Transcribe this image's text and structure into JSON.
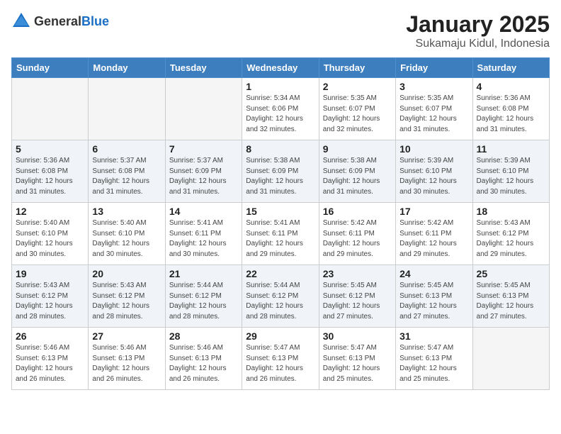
{
  "header": {
    "logo_general": "General",
    "logo_blue": "Blue",
    "title": "January 2025",
    "location": "Sukamaju Kidul, Indonesia"
  },
  "weekdays": [
    "Sunday",
    "Monday",
    "Tuesday",
    "Wednesday",
    "Thursday",
    "Friday",
    "Saturday"
  ],
  "weeks": [
    [
      {
        "day": "",
        "info": ""
      },
      {
        "day": "",
        "info": ""
      },
      {
        "day": "",
        "info": ""
      },
      {
        "day": "1",
        "info": "Sunrise: 5:34 AM\nSunset: 6:06 PM\nDaylight: 12 hours\nand 32 minutes."
      },
      {
        "day": "2",
        "info": "Sunrise: 5:35 AM\nSunset: 6:07 PM\nDaylight: 12 hours\nand 32 minutes."
      },
      {
        "day": "3",
        "info": "Sunrise: 5:35 AM\nSunset: 6:07 PM\nDaylight: 12 hours\nand 31 minutes."
      },
      {
        "day": "4",
        "info": "Sunrise: 5:36 AM\nSunset: 6:08 PM\nDaylight: 12 hours\nand 31 minutes."
      }
    ],
    [
      {
        "day": "5",
        "info": "Sunrise: 5:36 AM\nSunset: 6:08 PM\nDaylight: 12 hours\nand 31 minutes."
      },
      {
        "day": "6",
        "info": "Sunrise: 5:37 AM\nSunset: 6:08 PM\nDaylight: 12 hours\nand 31 minutes."
      },
      {
        "day": "7",
        "info": "Sunrise: 5:37 AM\nSunset: 6:09 PM\nDaylight: 12 hours\nand 31 minutes."
      },
      {
        "day": "8",
        "info": "Sunrise: 5:38 AM\nSunset: 6:09 PM\nDaylight: 12 hours\nand 31 minutes."
      },
      {
        "day": "9",
        "info": "Sunrise: 5:38 AM\nSunset: 6:09 PM\nDaylight: 12 hours\nand 31 minutes."
      },
      {
        "day": "10",
        "info": "Sunrise: 5:39 AM\nSunset: 6:10 PM\nDaylight: 12 hours\nand 30 minutes."
      },
      {
        "day": "11",
        "info": "Sunrise: 5:39 AM\nSunset: 6:10 PM\nDaylight: 12 hours\nand 30 minutes."
      }
    ],
    [
      {
        "day": "12",
        "info": "Sunrise: 5:40 AM\nSunset: 6:10 PM\nDaylight: 12 hours\nand 30 minutes."
      },
      {
        "day": "13",
        "info": "Sunrise: 5:40 AM\nSunset: 6:10 PM\nDaylight: 12 hours\nand 30 minutes."
      },
      {
        "day": "14",
        "info": "Sunrise: 5:41 AM\nSunset: 6:11 PM\nDaylight: 12 hours\nand 30 minutes."
      },
      {
        "day": "15",
        "info": "Sunrise: 5:41 AM\nSunset: 6:11 PM\nDaylight: 12 hours\nand 29 minutes."
      },
      {
        "day": "16",
        "info": "Sunrise: 5:42 AM\nSunset: 6:11 PM\nDaylight: 12 hours\nand 29 minutes."
      },
      {
        "day": "17",
        "info": "Sunrise: 5:42 AM\nSunset: 6:11 PM\nDaylight: 12 hours\nand 29 minutes."
      },
      {
        "day": "18",
        "info": "Sunrise: 5:43 AM\nSunset: 6:12 PM\nDaylight: 12 hours\nand 29 minutes."
      }
    ],
    [
      {
        "day": "19",
        "info": "Sunrise: 5:43 AM\nSunset: 6:12 PM\nDaylight: 12 hours\nand 28 minutes."
      },
      {
        "day": "20",
        "info": "Sunrise: 5:43 AM\nSunset: 6:12 PM\nDaylight: 12 hours\nand 28 minutes."
      },
      {
        "day": "21",
        "info": "Sunrise: 5:44 AM\nSunset: 6:12 PM\nDaylight: 12 hours\nand 28 minutes."
      },
      {
        "day": "22",
        "info": "Sunrise: 5:44 AM\nSunset: 6:12 PM\nDaylight: 12 hours\nand 28 minutes."
      },
      {
        "day": "23",
        "info": "Sunrise: 5:45 AM\nSunset: 6:12 PM\nDaylight: 12 hours\nand 27 minutes."
      },
      {
        "day": "24",
        "info": "Sunrise: 5:45 AM\nSunset: 6:13 PM\nDaylight: 12 hours\nand 27 minutes."
      },
      {
        "day": "25",
        "info": "Sunrise: 5:45 AM\nSunset: 6:13 PM\nDaylight: 12 hours\nand 27 minutes."
      }
    ],
    [
      {
        "day": "26",
        "info": "Sunrise: 5:46 AM\nSunset: 6:13 PM\nDaylight: 12 hours\nand 26 minutes."
      },
      {
        "day": "27",
        "info": "Sunrise: 5:46 AM\nSunset: 6:13 PM\nDaylight: 12 hours\nand 26 minutes."
      },
      {
        "day": "28",
        "info": "Sunrise: 5:46 AM\nSunset: 6:13 PM\nDaylight: 12 hours\nand 26 minutes."
      },
      {
        "day": "29",
        "info": "Sunrise: 5:47 AM\nSunset: 6:13 PM\nDaylight: 12 hours\nand 26 minutes."
      },
      {
        "day": "30",
        "info": "Sunrise: 5:47 AM\nSunset: 6:13 PM\nDaylight: 12 hours\nand 25 minutes."
      },
      {
        "day": "31",
        "info": "Sunrise: 5:47 AM\nSunset: 6:13 PM\nDaylight: 12 hours\nand 25 minutes."
      },
      {
        "day": "",
        "info": ""
      }
    ]
  ]
}
